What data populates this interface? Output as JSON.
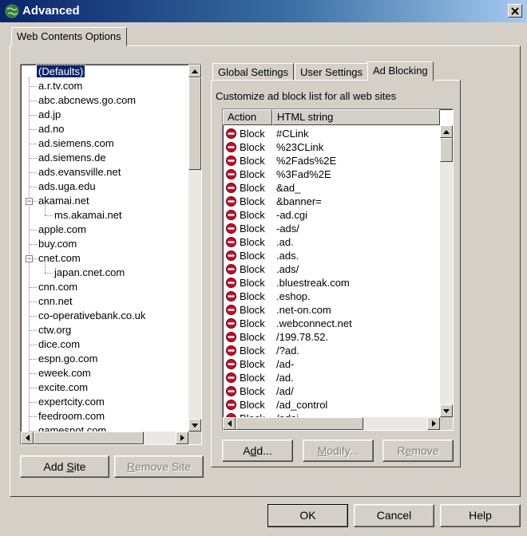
{
  "window": {
    "title": "Advanced"
  },
  "outer_tab": {
    "label": "Web Contents Options"
  },
  "sites": [
    {
      "label": "(Defaults)",
      "level": 0,
      "selected": true
    },
    {
      "label": "a.r.tv.com",
      "level": 0
    },
    {
      "label": "abc.abcnews.go.com",
      "level": 0
    },
    {
      "label": "ad.jp",
      "level": 0
    },
    {
      "label": "ad.no",
      "level": 0
    },
    {
      "label": "ad.siemens.com",
      "level": 0
    },
    {
      "label": "ad.siemens.de",
      "level": 0
    },
    {
      "label": "ads.evansville.net",
      "level": 0
    },
    {
      "label": "ads.uga.edu",
      "level": 0
    },
    {
      "label": "akamai.net",
      "level": 0,
      "expanded": true
    },
    {
      "label": "ms.akamai.net",
      "level": 1
    },
    {
      "label": "apple.com",
      "level": 0
    },
    {
      "label": "buy.com",
      "level": 0
    },
    {
      "label": "cnet.com",
      "level": 0,
      "expanded": true
    },
    {
      "label": "japan.cnet.com",
      "level": 1
    },
    {
      "label": "cnn.com",
      "level": 0
    },
    {
      "label": "cnn.net",
      "level": 0
    },
    {
      "label": "co-operativebank.co.uk",
      "level": 0
    },
    {
      "label": "ctw.org",
      "level": 0
    },
    {
      "label": "dice.com",
      "level": 0
    },
    {
      "label": "espn.go.com",
      "level": 0
    },
    {
      "label": "eweek.com",
      "level": 0
    },
    {
      "label": "excite.com",
      "level": 0
    },
    {
      "label": "expertcity.com",
      "level": 0
    },
    {
      "label": "feedroom.com",
      "level": 0
    },
    {
      "label": "gamesnot.com",
      "level": 0
    }
  ],
  "site_buttons": {
    "add_site": {
      "pre": "Add ",
      "key": "S",
      "post": "ite"
    },
    "remove_site": {
      "pre": "",
      "key": "R",
      "post": "emove Site"
    }
  },
  "inner_tabs": [
    {
      "label": "Global Settings"
    },
    {
      "label": "User Settings"
    },
    {
      "label": "Ad Blocking",
      "active": true
    }
  ],
  "ad_blocking": {
    "caption": "Customize ad block list for all web sites",
    "col_action": "Action",
    "col_html": "HTML string",
    "rows": [
      {
        "action": "Block",
        "html": "#CLink"
      },
      {
        "action": "Block",
        "html": "%23CLink"
      },
      {
        "action": "Block",
        "html": "%2Fads%2E"
      },
      {
        "action": "Block",
        "html": "%3Fad%2E"
      },
      {
        "action": "Block",
        "html": "&ad_"
      },
      {
        "action": "Block",
        "html": "&banner="
      },
      {
        "action": "Block",
        "html": "-ad.cgi"
      },
      {
        "action": "Block",
        "html": "-ads/"
      },
      {
        "action": "Block",
        "html": ".ad."
      },
      {
        "action": "Block",
        "html": ".ads."
      },
      {
        "action": "Block",
        "html": ".ads/"
      },
      {
        "action": "Block",
        "html": ".bluestreak.com"
      },
      {
        "action": "Block",
        "html": ".eshop."
      },
      {
        "action": "Block",
        "html": ".net-on.com"
      },
      {
        "action": "Block",
        "html": ".webconnect.net"
      },
      {
        "action": "Block",
        "html": "/199.78.52."
      },
      {
        "action": "Block",
        "html": "/?ad."
      },
      {
        "action": "Block",
        "html": "/ad-"
      },
      {
        "action": "Block",
        "html": "/ad."
      },
      {
        "action": "Block",
        "html": "/ad/"
      },
      {
        "action": "Block",
        "html": "/ad_control"
      },
      {
        "action": "Block",
        "html": "/adai"
      }
    ],
    "buttons": {
      "add": {
        "pre": "A",
        "key": "d",
        "post": "d..."
      },
      "modify": {
        "pre": "",
        "key": "M",
        "post": "odify..."
      },
      "remove": {
        "pre": "R",
        "key": "e",
        "post": "move"
      }
    }
  },
  "footer": {
    "ok": "OK",
    "cancel": "Cancel",
    "help": "Help"
  },
  "colors": {
    "title_gradient_start": "#0a246a",
    "selection": "#0a246a",
    "block_icon": "#c0102a"
  },
  "icons": [
    "globe-icon",
    "close-icon",
    "block-icon",
    "arrow-up-icon",
    "arrow-down-icon",
    "arrow-left-icon",
    "arrow-right-icon"
  ]
}
